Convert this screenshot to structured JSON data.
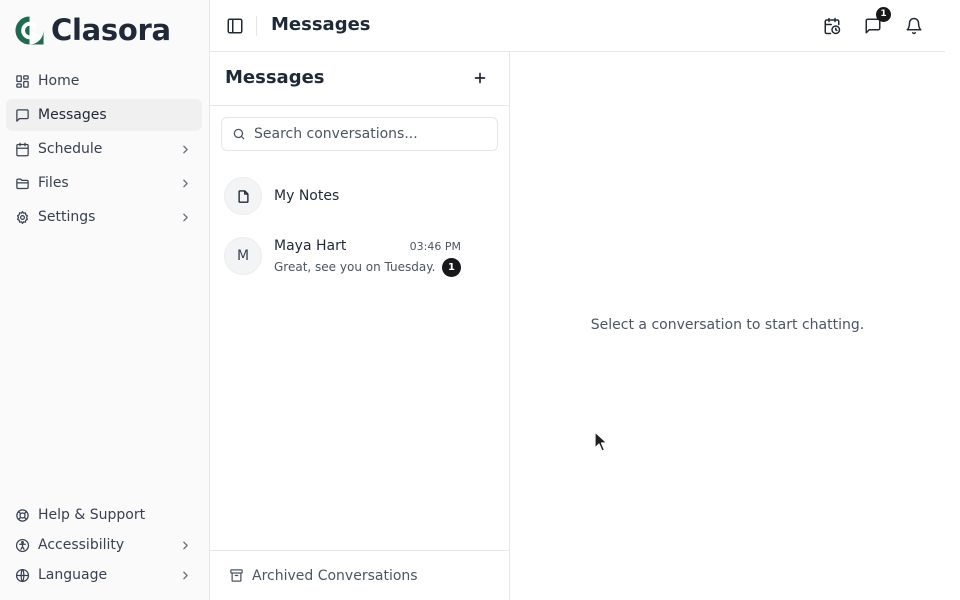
{
  "brand": {
    "name": "Clasora",
    "color": "#1e6b52"
  },
  "sidebar": {
    "items": [
      {
        "label": "Home",
        "icon": "grid-icon",
        "active": false,
        "has_chevron": false
      },
      {
        "label": "Messages",
        "icon": "message-square-icon",
        "active": true,
        "has_chevron": false
      },
      {
        "label": "Schedule",
        "icon": "calendar-icon",
        "active": false,
        "has_chevron": true
      },
      {
        "label": "Files",
        "icon": "folder-icon",
        "active": false,
        "has_chevron": true
      },
      {
        "label": "Settings",
        "icon": "gear-icon",
        "active": false,
        "has_chevron": true
      }
    ],
    "bottom_items": [
      {
        "label": "Help & Support",
        "icon": "lifebuoy-icon",
        "has_chevron": false
      },
      {
        "label": "Accessibility",
        "icon": "accessibility-icon",
        "has_chevron": true
      },
      {
        "label": "Language",
        "icon": "globe-icon",
        "has_chevron": true
      }
    ]
  },
  "topbar": {
    "title": "Messages",
    "icons": [
      "calendar-clock-icon",
      "message-square-icon",
      "bell-icon"
    ],
    "messages_badge": "1"
  },
  "conversations_panel": {
    "title": "Messages",
    "search": {
      "placeholder": "Search conversations...",
      "value": ""
    },
    "items": [
      {
        "name": "My Notes",
        "avatar_icon": "file-icon"
      },
      {
        "name": "Maya Hart",
        "avatar_initial": "M",
        "time": "03:46 PM",
        "preview": "Great, see you on Tuesday.",
        "unread": "1"
      }
    ],
    "archived_label": "Archived Conversations"
  },
  "chat": {
    "empty_state": "Select a conversation to start chatting."
  }
}
